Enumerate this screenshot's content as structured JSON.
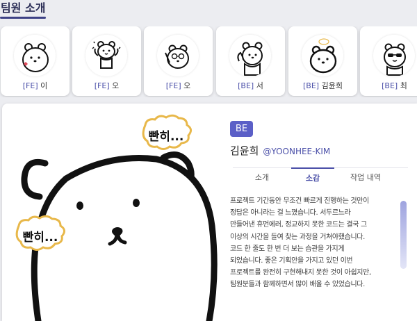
{
  "section": {
    "title": "팀원 소개"
  },
  "members": [
    {
      "team": "[FE]",
      "name": "이"
    },
    {
      "team": "[FE]",
      "name": "오"
    },
    {
      "team": "[FE]",
      "name": "오"
    },
    {
      "team": "[BE]",
      "name": "서"
    },
    {
      "team": "[BE]",
      "name": "김윤희"
    },
    {
      "team": "[BE]",
      "name": "최"
    }
  ],
  "detail": {
    "team_badge": "BE",
    "name": "김윤희",
    "handle": "@YOONHEE-KIM",
    "tabs": [
      {
        "label": "소개"
      },
      {
        "label": "소감"
      },
      {
        "label": "작업 내역"
      }
    ],
    "active_tab": "소감",
    "intro_lines": [
      "프로젝트 기간동안 무조건 빠르게 진행하는 것만이",
      "정답은 아니라는 걸 느꼈습니다. 서두르느라",
      "만들어낸 휴먼에러, 정교하지 못한 코드는 결국 그",
      "이상의 시간을 들여 찾는 과정을 거쳐야했습니다.",
      "코드 한 줄도 한 번 더 보는 습관을 가지게",
      "되었습니다. 좋은 기획안을 가지고 있던 이번",
      "프로젝트를 완전히 구현해내지 못한 것이 아쉽지만,",
      "팀원분들과 함께하면서 많이 배울 수 있었습니다."
    ],
    "hero_bubbles": [
      "빤히...",
      "빤히..."
    ]
  },
  "colors": {
    "accent": "#5b5fc7",
    "team_text": "#4a4fa8",
    "title": "#2c2f57"
  }
}
